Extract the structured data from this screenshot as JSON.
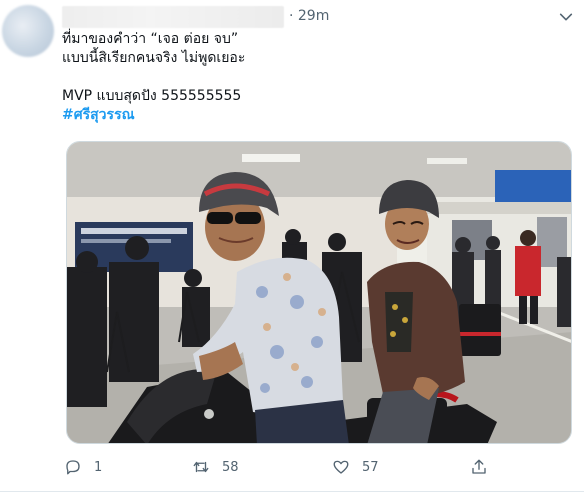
{
  "tweet": {
    "time": "· 29m",
    "text_lines": [
      "ที่มาของคำว่า “เจอ ต่อย จบ”",
      "แบบนี้สิเรียกคนจริง ไม่พูดเยอะ",
      "",
      "MVP แบบสุดปัง 555555555"
    ],
    "hashtag": "#ศรีสุวรรณ"
  },
  "actions": {
    "reply_count": "1",
    "retweet_count": "58",
    "like_count": "57"
  },
  "icons": {
    "caret": "chevron-down-icon",
    "reply": "reply-icon",
    "retweet": "retweet-icon",
    "like": "heart-icon",
    "share": "share-icon"
  },
  "colors": {
    "accent": "#1d9bf0",
    "muted": "#536471"
  }
}
